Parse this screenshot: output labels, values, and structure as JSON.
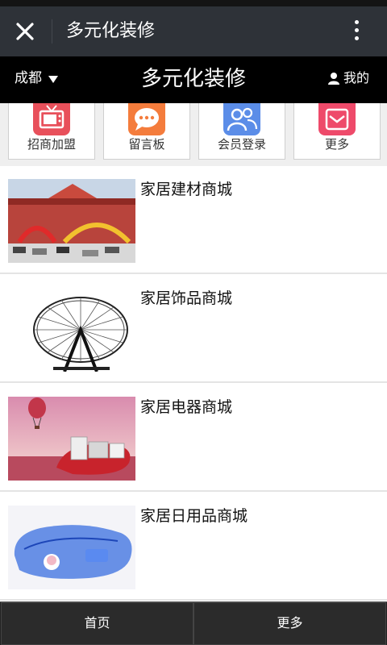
{
  "wechat": {
    "title": "多元化装修",
    "close_icon": "close-icon",
    "more_icon": "more-vertical-icon"
  },
  "header": {
    "city": "成都",
    "title": "多元化装修",
    "mine": "我的"
  },
  "menu": {
    "items": [
      {
        "label": "招商加盟",
        "icon": "tv-icon",
        "color": "#e8505b"
      },
      {
        "label": "留言板",
        "icon": "chat-icon",
        "color": "#f47c3c"
      },
      {
        "label": "会员登录",
        "icon": "users-icon",
        "color": "#5b8de8"
      },
      {
        "label": "更多",
        "icon": "more-icon",
        "color": "#ee4a6a"
      }
    ]
  },
  "list": {
    "items": [
      {
        "name": "家居建材商城"
      },
      {
        "name": "家居饰品商城"
      },
      {
        "name": "家居电器商城"
      },
      {
        "name": "家居日用品商城"
      }
    ]
  },
  "bottom": {
    "home": "首页",
    "more": "更多"
  }
}
